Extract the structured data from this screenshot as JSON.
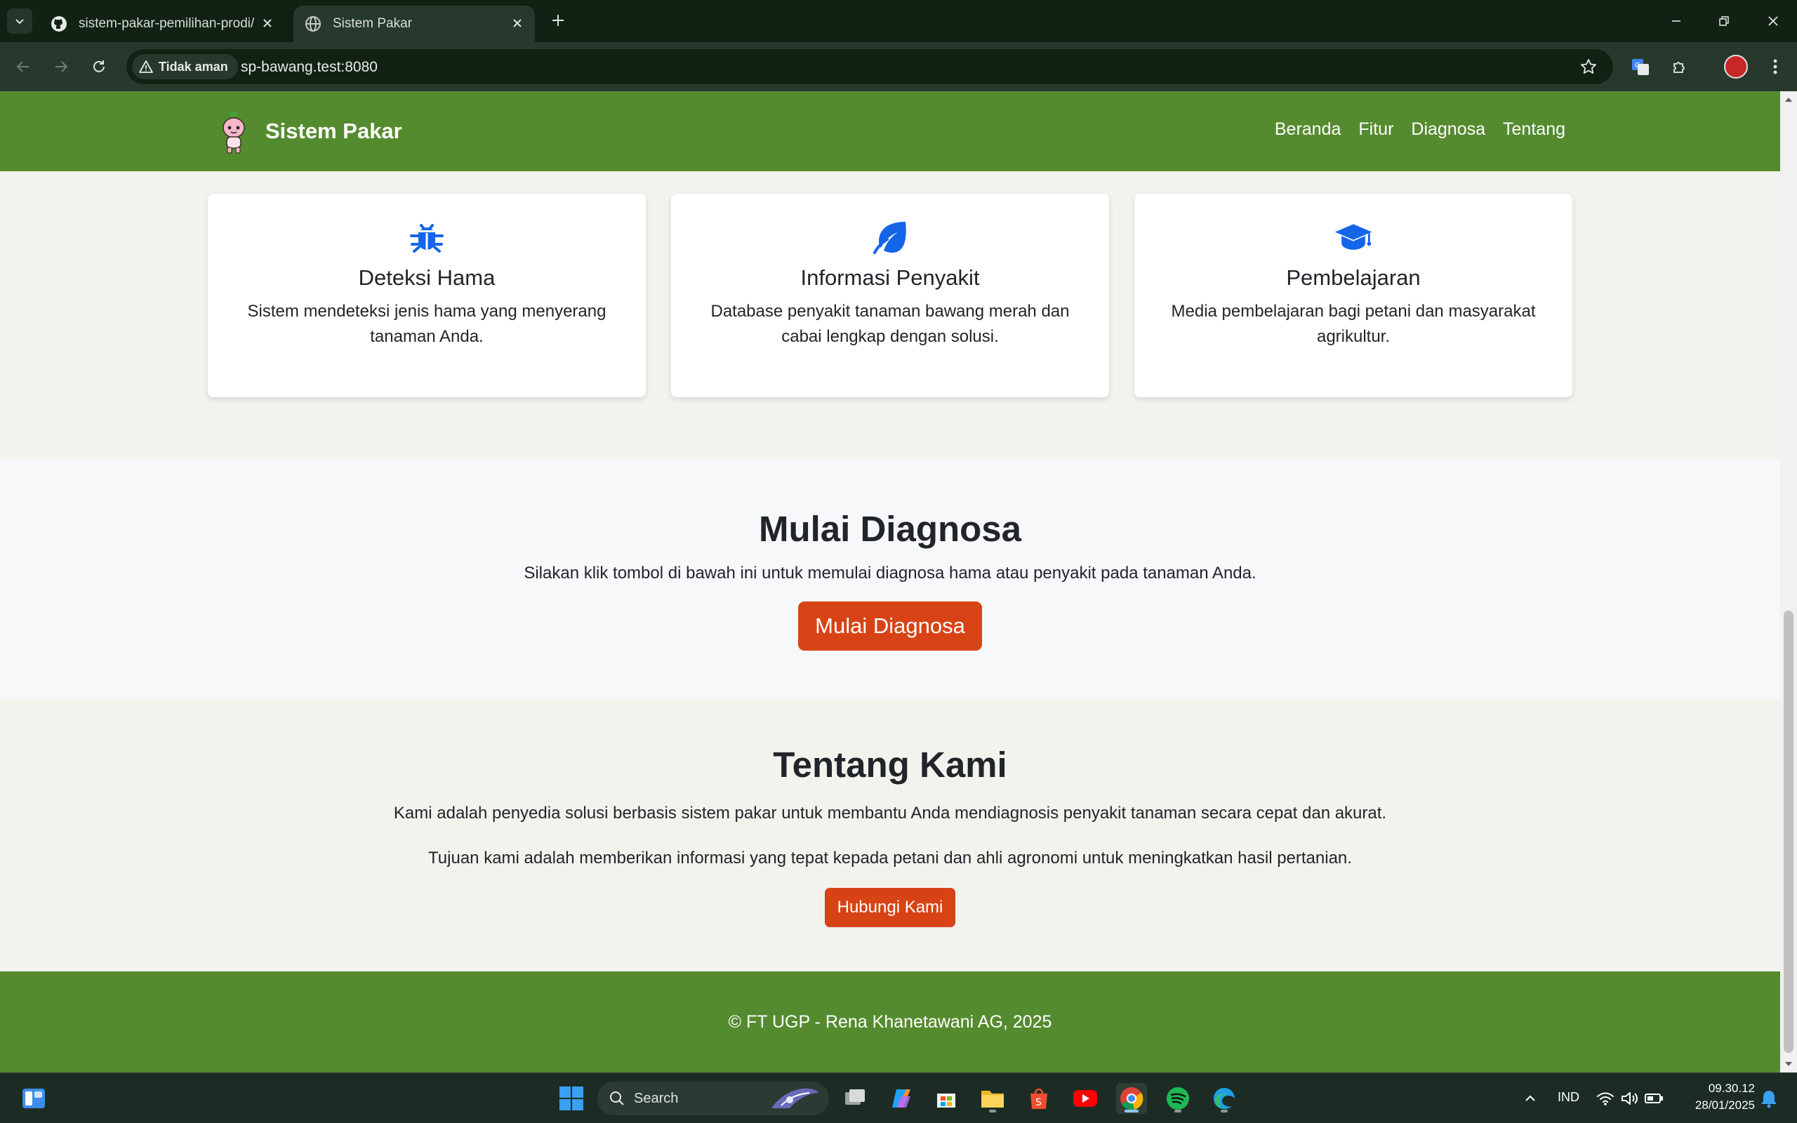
{
  "browser": {
    "tabs": [
      {
        "title": "sistem-pakar-pemilihan-prodi/"
      },
      {
        "title": "Sistem Pakar"
      }
    ],
    "security_label": "Tidak aman",
    "url": "sp-bawang.test:8080"
  },
  "site": {
    "brand": "Sistem Pakar",
    "nav": [
      "Beranda",
      "Fitur",
      "Diagnosa",
      "Tentang"
    ],
    "features": [
      {
        "icon": "bug-icon",
        "title": "Deteksi Hama",
        "text": "Sistem mendeteksi jenis hama yang menyerang tanaman Anda."
      },
      {
        "icon": "leaf-icon",
        "title": "Informasi Penyakit",
        "text": "Database penyakit tanaman bawang merah dan cabai lengkap dengan solusi."
      },
      {
        "icon": "graduation-cap-icon",
        "title": "Pembelajaran",
        "text": "Media pembelajaran bagi petani dan masyarakat agrikultur."
      }
    ],
    "diagnosis": {
      "title": "Mulai Diagnosa",
      "text": "Silakan klik tombol di bawah ini untuk memulai diagnosa hama atau penyakit pada tanaman Anda.",
      "button": "Mulai Diagnosa"
    },
    "about": {
      "title": "Tentang Kami",
      "p1": "Kami adalah penyedia solusi berbasis sistem pakar untuk membantu Anda mendiagnosis penyakit tanaman secara cepat dan akurat.",
      "p2": "Tujuan kami adalah memberikan informasi yang tepat kepada petani dan ahli agronomi untuk meningkatkan hasil pertanian.",
      "button": "Hubungi Kami"
    },
    "footer": "© FT UGP - Rena Khanetawani AG, 2025"
  },
  "taskbar": {
    "search_label": "Search",
    "language": "IND",
    "time": "09.30.12",
    "date": "28/01/2025"
  },
  "colors": {
    "brand_green": "#558b2f",
    "accent_orange": "#d84315",
    "icon_blue": "#1565e8"
  }
}
